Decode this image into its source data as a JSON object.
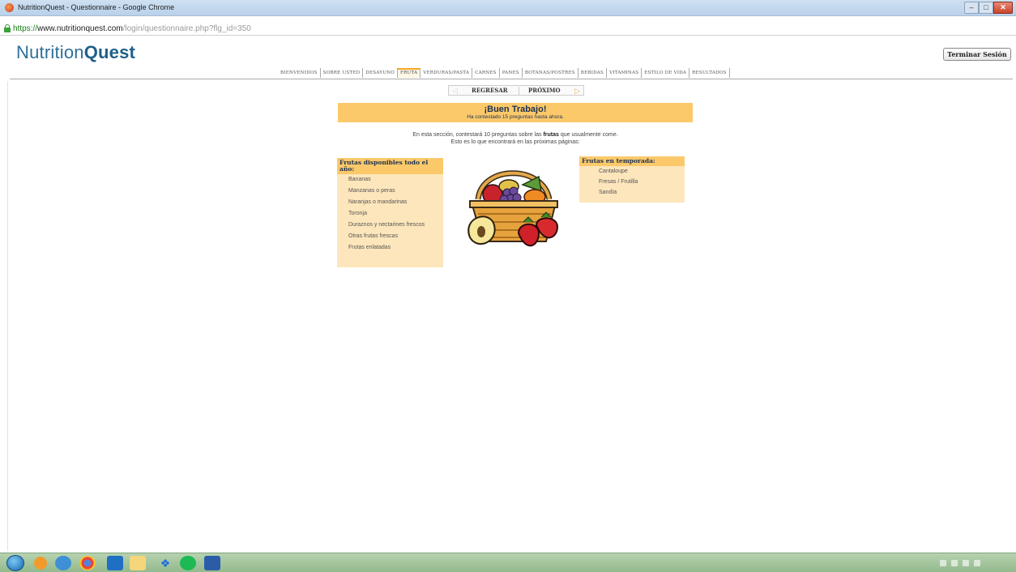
{
  "window": {
    "title": "NutritionQuest - Questionnaire - Google Chrome",
    "controls": {
      "minimize": "–",
      "maximize": "□",
      "close": "✕"
    }
  },
  "address": {
    "scheme": "https://",
    "host": "www.nutritionquest.com",
    "path": "/login/questionnaire.php?flg_id=350"
  },
  "header": {
    "logo_light": "Nutrition",
    "logo_bold": "Quest",
    "logout_label": "Terminar Sesión"
  },
  "nav": {
    "tabs": [
      {
        "label": "BIENVENIDOS"
      },
      {
        "label": "SOBRE USTED"
      },
      {
        "label": "DESAYUNO"
      },
      {
        "label": "FRUTA",
        "active": true
      },
      {
        "label": "VERDURAS/PASTA"
      },
      {
        "label": "CARNES"
      },
      {
        "label": "PANES"
      },
      {
        "label": "BOTANAS/POSTRES"
      },
      {
        "label": "BEBIDAS"
      },
      {
        "label": "VITAMINAS"
      },
      {
        "label": "ESTILO DE VIDA"
      },
      {
        "label": "RESULTADOS"
      }
    ]
  },
  "pager": {
    "prev_label": "REGRESAR",
    "next_label": "PRÓXIMO",
    "prev_icon": "chevron-left-icon",
    "next_icon": "chevron-right-icon"
  },
  "banner": {
    "heading": "¡Buen Trabajo!",
    "subtext": "Ha contestado 15  preguntas hasta ahora."
  },
  "intro": {
    "line1_before": "En esta sección, contestará 10 preguntas sobre las ",
    "line1_bold": "frutas",
    "line1_after": " que usualmente come.",
    "line2": "Esto es lo que encontrará en las próximas páginas:"
  },
  "left_panel": {
    "heading": "Frutas disponibles todo el año:",
    "items": [
      "Bananas",
      "Manzanas o peras",
      "Naranjas o mandarinas",
      "Toronja",
      "Duraznos y nectarines frescos",
      "Otras frutas frescas",
      "Frutas enlatadas"
    ]
  },
  "right_panel": {
    "heading": "Frutas en temporada:",
    "items": [
      "Cantaloupe",
      "Fresas / Frutilla",
      "Sandía"
    ]
  },
  "colors": {
    "brand_blue": "#2e6f9a",
    "banner_orange": "#fcc96a",
    "panel_bg": "#fde6bb",
    "heading_navy": "#1d3050"
  }
}
